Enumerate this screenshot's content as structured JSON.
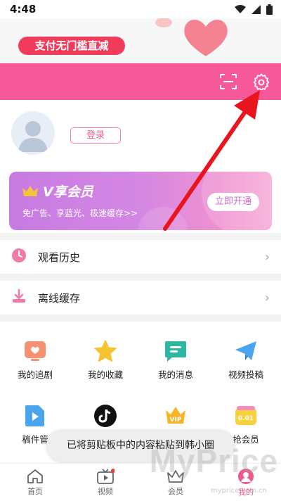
{
  "status_bar": {
    "time": "4:48"
  },
  "promo": {
    "pill_text": "支付无门槛直减"
  },
  "profile": {
    "login_label": "登录"
  },
  "vip": {
    "title": "V享会员",
    "subtitle": "免广告、享蓝光、极速缓存>>",
    "button": "立即开通"
  },
  "list": [
    {
      "label": "观看历史"
    },
    {
      "label": "离线缓存"
    }
  ],
  "grid": [
    {
      "label": "我的追剧",
      "icon": "tv-heart-icon"
    },
    {
      "label": "我的收藏",
      "icon": "star-icon"
    },
    {
      "label": "我的消息",
      "icon": "message-icon"
    },
    {
      "label": "视频投稿",
      "icon": "send-icon"
    },
    {
      "label": "稿件管",
      "icon": "video-file-icon"
    },
    {
      "label": "",
      "icon": "tiktok-icon"
    },
    {
      "label": "",
      "icon": "vip-crown-icon"
    },
    {
      "label": "抢会员",
      "icon": "coupon-icon"
    }
  ],
  "nav": [
    {
      "label": "首页"
    },
    {
      "label": "视频"
    },
    {
      "label": "会员"
    },
    {
      "label": "我的"
    }
  ],
  "toast": "已将剪贴板中的内容粘贴到韩小圈",
  "watermark": {
    "text": "MyPrice",
    "sub": "myprice.com.cn"
  },
  "colors": {
    "accent": "#f7589a",
    "vip_start": "#c77be2",
    "vip_end": "#f7aad7",
    "arrow": "#e8141e"
  }
}
